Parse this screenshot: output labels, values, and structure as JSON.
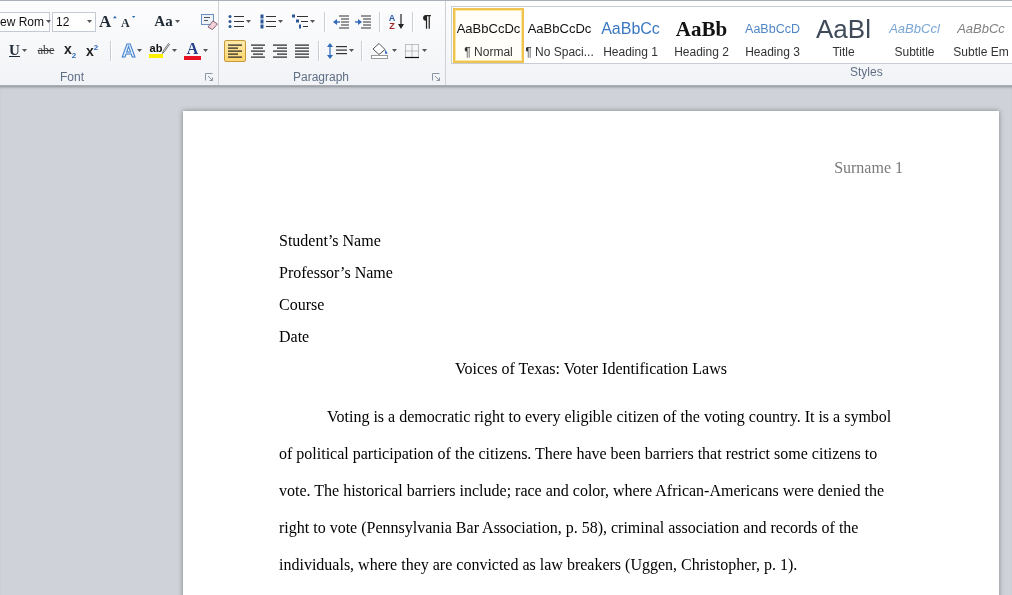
{
  "ribbon": {
    "font_group": {
      "label": "Font",
      "font_name": "ew Rom",
      "font_size": "12",
      "row1": [
        [
          {
            "kind": "grow_font",
            "glyph": "A"
          },
          {
            "kind": "shrink_font",
            "glyph": "A"
          }
        ],
        [
          {
            "kind": "change_case",
            "glyph": "Aa"
          }
        ],
        [
          {
            "kind": "clear_formatting"
          }
        ]
      ],
      "row2": [
        [
          {
            "kind": "underline",
            "glyph": "U"
          },
          {
            "kind": "strikethrough",
            "glyph": "abe"
          },
          {
            "kind": "subscript",
            "glyph": "x$_{2}$"
          },
          {
            "kind": "superscript",
            "glyph": "x$^{2}$"
          }
        ],
        [
          {
            "kind": "text_effects",
            "glyph": "A"
          },
          {
            "kind": "highlight",
            "glyph": "ab"
          },
          {
            "kind": "font_color",
            "glyph": "A"
          }
        ]
      ]
    },
    "paragraph_group": {
      "label": "Paragraph",
      "row1": [
        [
          {
            "kind": "bullets"
          },
          {
            "kind": "numbering"
          },
          {
            "kind": "multilevel"
          }
        ],
        [
          {
            "kind": "decrease_indent"
          },
          {
            "kind": "increase_indent"
          }
        ],
        [
          {
            "kind": "sort",
            "glyph": "AZ"
          }
        ],
        [
          {
            "kind": "show_marks",
            "glyph": "¶"
          }
        ]
      ],
      "row2": [
        [
          {
            "kind": "align_left",
            "selected": true
          },
          {
            "kind": "align_center",
            "selected": false
          },
          {
            "kind": "align_right",
            "selected": false
          },
          {
            "kind": "justify",
            "selected": false
          }
        ],
        [
          {
            "kind": "line_spacing"
          }
        ],
        [
          {
            "kind": "shading"
          },
          {
            "kind": "borders"
          }
        ]
      ]
    },
    "styles_group": {
      "label": "Styles",
      "items": [
        {
          "kind": "normal",
          "preview": "AaBbCcDc",
          "label": "¶ Normal",
          "selected": true
        },
        {
          "kind": "no_spacing",
          "preview": "AaBbCcDc",
          "label": "¶ No Spaci...",
          "selected": false
        },
        {
          "kind": "heading_1",
          "preview": "AaBbCc",
          "label": "Heading 1",
          "selected": false
        },
        {
          "kind": "heading_2",
          "preview": "AaBb",
          "label": "Heading 2",
          "selected": false
        },
        {
          "kind": "heading_3",
          "preview": "AaBbCcD",
          "label": "Heading 3",
          "selected": false
        },
        {
          "kind": "title",
          "preview": "AaBl",
          "label": "Title",
          "selected": false
        },
        {
          "kind": "subtitle",
          "preview": "AaBbCcl",
          "label": "Subtitle",
          "selected": false
        },
        {
          "kind": "subtle_emphasis",
          "preview": "AaBbCc",
          "label": "Subtle Em",
          "selected": false
        }
      ]
    }
  },
  "document": {
    "header": "Surname 1",
    "heading_lines": [
      "Student’s Name",
      "Professor’s Name",
      "Course",
      "Date"
    ],
    "title": "Voices of Texas: Voter Identification Laws",
    "paragraphs": [
      "Voting is a democratic right to every eligible citizen of the voting country. It is a symbol of political participation of the citizens. There have been barriers that restrict some citizens to vote. The historical barriers include; race and color, where African-Americans were denied the right to vote (Pennsylvania Bar Association, p. 58), criminal association and records of the individuals, where they are convicted as law breakers (Uggen, Christopher, p. 1)."
    ]
  }
}
